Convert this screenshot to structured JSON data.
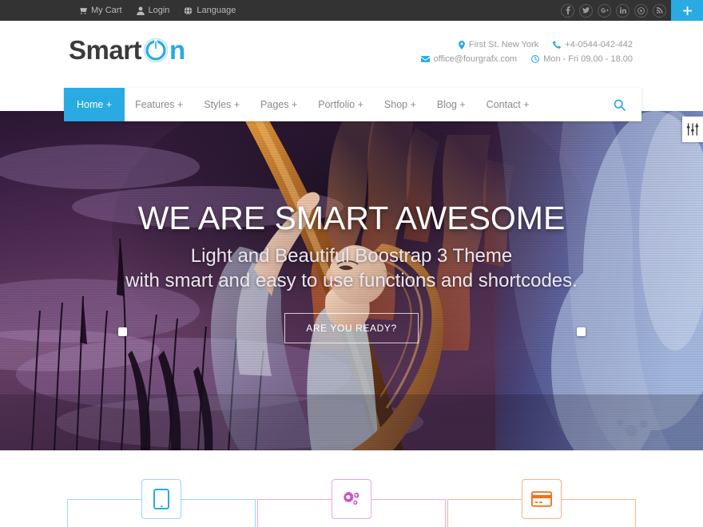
{
  "topbar": {
    "items": [
      {
        "label": "My Cart",
        "icon": "cart-icon"
      },
      {
        "label": "Login",
        "icon": "user-icon"
      },
      {
        "label": "Language",
        "icon": "globe-icon"
      }
    ],
    "social": [
      {
        "name": "facebook-icon",
        "glyph": "f"
      },
      {
        "name": "twitter-icon",
        "glyph": "t"
      },
      {
        "name": "google-plus-icon",
        "glyph": "g"
      },
      {
        "name": "linkedin-icon",
        "glyph": "in"
      },
      {
        "name": "dribbble-icon",
        "glyph": "d"
      },
      {
        "name": "rss-icon",
        "glyph": "r"
      }
    ],
    "plus_label": "+",
    "bg_color": "#333333"
  },
  "header": {
    "logo": {
      "text_dark": "Smart",
      "icon": "power-icon",
      "text_blue": "n"
    },
    "contact": {
      "address": "First St. New York",
      "phone": "+4-0544-042-442",
      "email": "office@fourgrafx.com",
      "hours": "Mon - Fri 09.00 - 18.00"
    }
  },
  "nav": {
    "items": [
      {
        "label": "Home +",
        "active": true
      },
      {
        "label": "Features +",
        "active": false
      },
      {
        "label": "Styles +",
        "active": false
      },
      {
        "label": "Pages +",
        "active": false
      },
      {
        "label": "Portfolio +",
        "active": false
      },
      {
        "label": "Shop +",
        "active": false
      },
      {
        "label": "Blog +",
        "active": false
      },
      {
        "label": "Contact +",
        "active": false
      }
    ],
    "search_icon": "search-icon",
    "accent_color": "#29aae2"
  },
  "hero": {
    "title": "WE ARE SMART AWESOME",
    "subtitle_line1": "Light and Beautiful Boostrap 3 Theme",
    "subtitle_line2": "with smart and easy to use functions and shortcodes.",
    "cta_label": "ARE YOU READY?",
    "scroll_icon": "chevron-up-icon",
    "slider_prev": "slider-prev-dot",
    "slider_next": "slider-next-dot"
  },
  "options_panel": {
    "icon": "sliders-icon"
  },
  "features": [
    {
      "icon": "tablet-icon",
      "color": "#29aae2",
      "light": "#9bd7f2"
    },
    {
      "icon": "gears-icon",
      "color": "#cc52cc",
      "light": "#e6a6e6"
    },
    {
      "icon": "credit-card-icon",
      "color": "#f4701f",
      "light": "#f8b183"
    }
  ]
}
